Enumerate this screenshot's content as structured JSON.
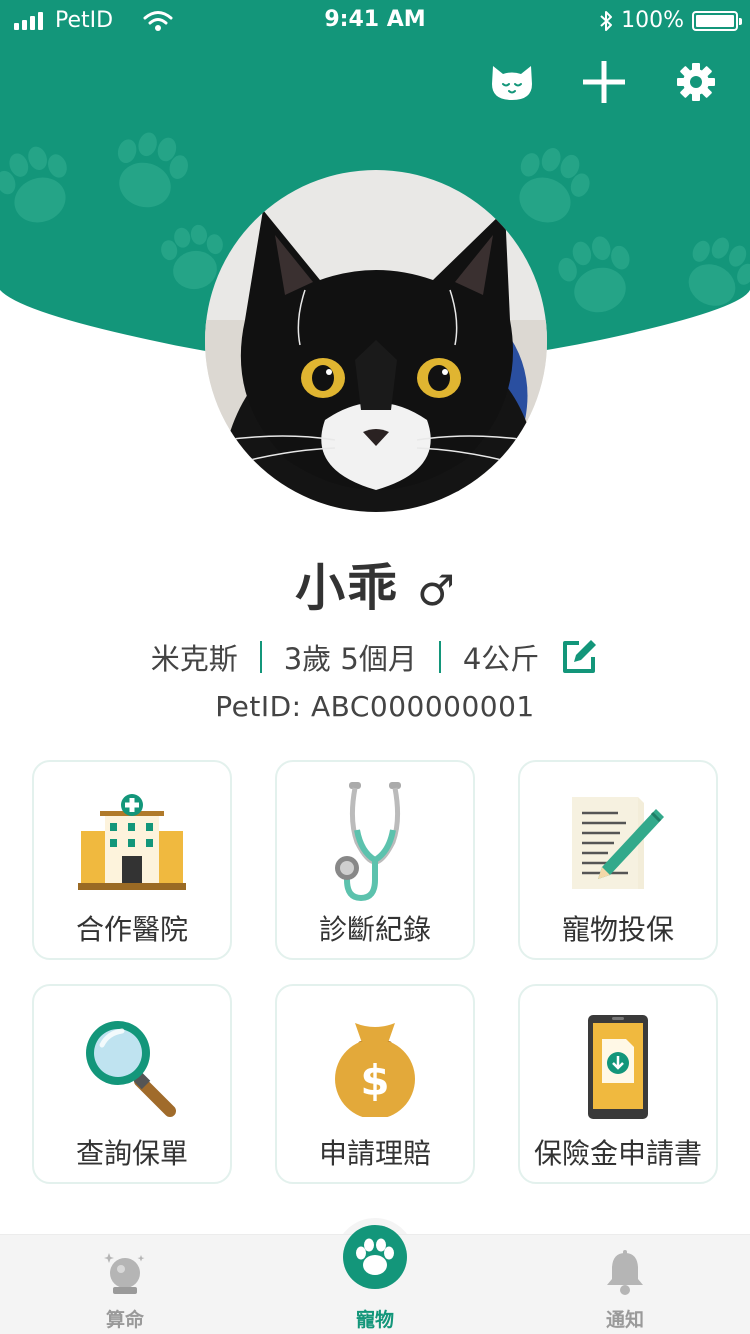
{
  "status_bar": {
    "carrier": "PetID",
    "time": "9:41 AM",
    "battery": "100%"
  },
  "top_actions": [
    {
      "icon": "cat-face-icon"
    },
    {
      "icon": "plus-icon"
    },
    {
      "icon": "gear-icon"
    }
  ],
  "colors": {
    "brand": "#13967a",
    "brand_light": "#2ca88d",
    "tab_inactive": "#9a9a9a"
  },
  "pet": {
    "name": "小乖",
    "gender_symbol": "♂",
    "breed": "米克斯",
    "age": "3歲 5個月",
    "weight": "4公斤",
    "petid": "PetID: ABC000000001"
  },
  "services": [
    {
      "label": "合作醫院",
      "icon": "hospital-icon"
    },
    {
      "label": "診斷紀錄",
      "icon": "stethoscope-icon"
    },
    {
      "label": "寵物投保",
      "icon": "document-pen-icon"
    },
    {
      "label": "查詢保單",
      "icon": "magnifier-icon"
    },
    {
      "label": "申請理賠",
      "icon": "money-bag-icon"
    },
    {
      "label": "保險金申請書",
      "icon": "phone-download-icon"
    }
  ],
  "tabs": [
    {
      "label": "算命",
      "icon": "crystal-ball-icon",
      "active": false
    },
    {
      "label": "寵物",
      "icon": "paw-icon",
      "active": true
    },
    {
      "label": "通知",
      "icon": "bell-icon",
      "active": false
    }
  ]
}
